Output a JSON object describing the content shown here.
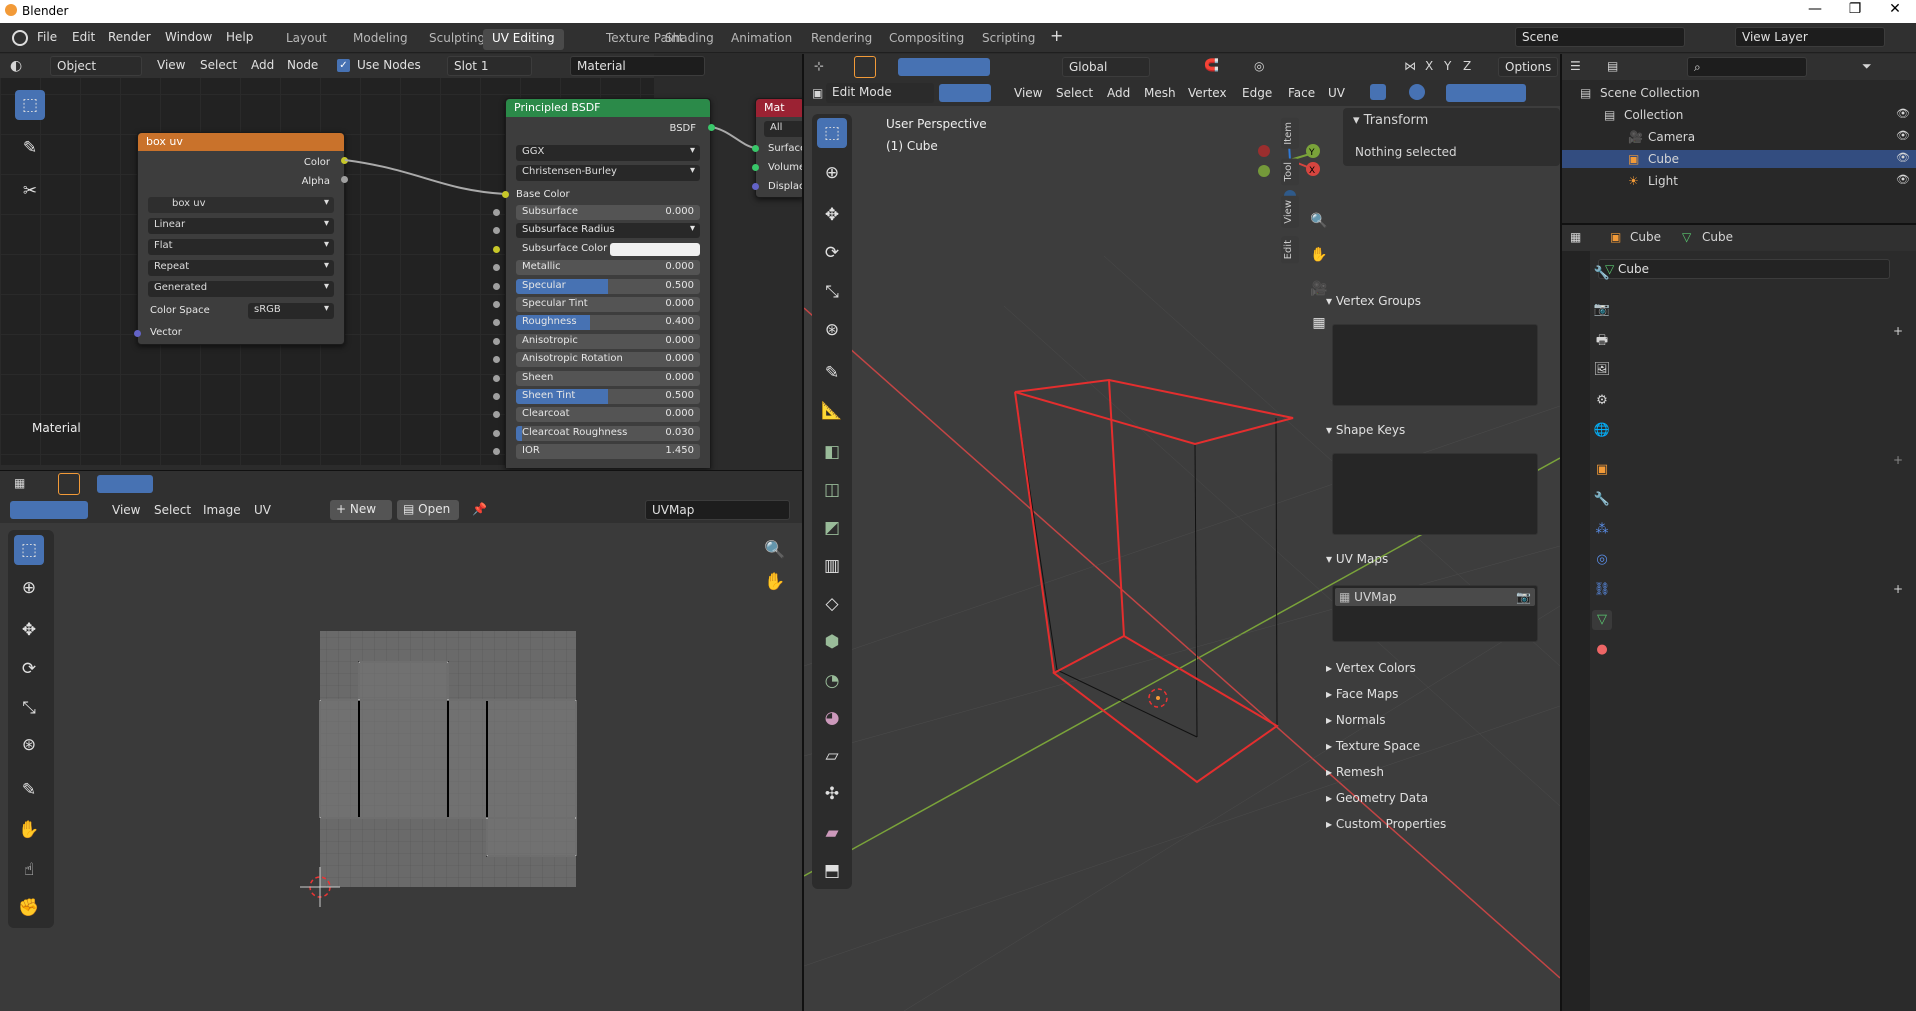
{
  "app": {
    "title": "Blender",
    "controls": [
      "—",
      "❐",
      "✕"
    ]
  },
  "menu": [
    "File",
    "Edit",
    "Render",
    "Window",
    "Help"
  ],
  "workspaces": [
    "Layout",
    "Modeling",
    "Sculpting",
    "UV Editing",
    "Texture Paint",
    "Shading",
    "Animation",
    "Rendering",
    "Compositing",
    "Scripting"
  ],
  "active_workspace": "UV Editing",
  "plus": "+",
  "scene": {
    "name": "Scene",
    "view_layer": "View Layer"
  },
  "node_editor": {
    "object_mode": "Object",
    "menus": [
      "View",
      "Select",
      "Add",
      "Node"
    ],
    "use_nodes": "Use Nodes",
    "slot": "Slot 1",
    "material": "Material",
    "area_label": "Material",
    "image_node": {
      "title": "box uv",
      "outputs": [
        "Color",
        "Alpha"
      ],
      "image": "box uv",
      "interp": "Linear",
      "projection": "Flat",
      "extension": "Repeat",
      "source": "Generated",
      "colorspace_label": "Color Space",
      "colorspace": "sRGB",
      "input": "Vector"
    },
    "bsdf": {
      "title": "Principled BSDF",
      "output": "BSDF",
      "distribution": "GGX",
      "sss_method": "Christensen-Burley",
      "base_color": "Base Color",
      "rows": [
        {
          "label": "Subsurface",
          "value": "0.000",
          "fill": 0
        },
        {
          "label": "Subsurface Radius",
          "value": "",
          "fill": 0,
          "dropdown": true
        },
        {
          "label": "Subsurface Color",
          "value": "",
          "fill": 0,
          "swatch": true
        },
        {
          "label": "Metallic",
          "value": "0.000",
          "fill": 0
        },
        {
          "label": "Specular",
          "value": "0.500",
          "fill": 0.5
        },
        {
          "label": "Specular Tint",
          "value": "0.000",
          "fill": 0
        },
        {
          "label": "Roughness",
          "value": "0.400",
          "fill": 0.4
        },
        {
          "label": "Anisotropic",
          "value": "0.000",
          "fill": 0
        },
        {
          "label": "Anisotropic Rotation",
          "value": "0.000",
          "fill": 0
        },
        {
          "label": "Sheen",
          "value": "0.000",
          "fill": 0
        },
        {
          "label": "Sheen Tint",
          "value": "0.500",
          "fill": 0.5
        },
        {
          "label": "Clearcoat",
          "value": "0.000",
          "fill": 0
        },
        {
          "label": "Clearcoat Roughness",
          "value": "0.030",
          "fill": 0.03
        },
        {
          "label": "IOR",
          "value": "1.450",
          "fill": 0
        }
      ]
    },
    "output_node": {
      "title": "Mat",
      "target": "All",
      "inputs": [
        "Surface",
        "Volume",
        "Displac"
      ]
    }
  },
  "uv_editor": {
    "menus": [
      "View",
      "Select",
      "Image",
      "UV"
    ],
    "new": "New",
    "open": "Open",
    "uvmap": "UVMap"
  },
  "viewport": {
    "mode": "Edit Mode",
    "menus": [
      "View",
      "Select",
      "Add",
      "Mesh",
      "Vertex",
      "Edge",
      "Face",
      "UV"
    ],
    "orientation": "Global",
    "options": "Options",
    "xyz": [
      "X",
      "Y",
      "Z"
    ],
    "perspective": "User Perspective",
    "object": "(1) Cube",
    "npanel": {
      "header": "Transform",
      "body": "Nothing selected",
      "tabs": [
        "Item",
        "Tool",
        "View",
        "Edit"
      ]
    },
    "gizmo": {
      "x": "X",
      "y": "Y",
      "z": "Z"
    }
  },
  "outliner": {
    "items": [
      {
        "label": "Scene Collection",
        "indent": 0,
        "icon": "collection-icon"
      },
      {
        "label": "Collection",
        "indent": 1,
        "icon": "collection-icon"
      },
      {
        "label": "Camera",
        "indent": 2,
        "icon": "camera-icon"
      },
      {
        "label": "Cube",
        "indent": 2,
        "icon": "cube-icon",
        "selected": true
      },
      {
        "label": "Light",
        "indent": 2,
        "icon": "light-icon"
      }
    ]
  },
  "properties": {
    "object": "Cube",
    "data": "Cube",
    "data_field": "Cube",
    "vertex_groups": "Vertex Groups",
    "shape_keys": "Shape Keys",
    "uv_maps": "UV Maps",
    "uv_map_item": "UVMap",
    "collapsed": [
      "Vertex Colors",
      "Face Maps",
      "Normals",
      "Texture Space",
      "Remesh",
      "Geometry Data",
      "Custom Properties"
    ]
  },
  "colors": {
    "accent": "#4772b3",
    "orange": "#f29a38",
    "header": "#303030",
    "bsdf": "#2b8a49",
    "image_node": "#c9722b",
    "output": "#9b2233"
  }
}
